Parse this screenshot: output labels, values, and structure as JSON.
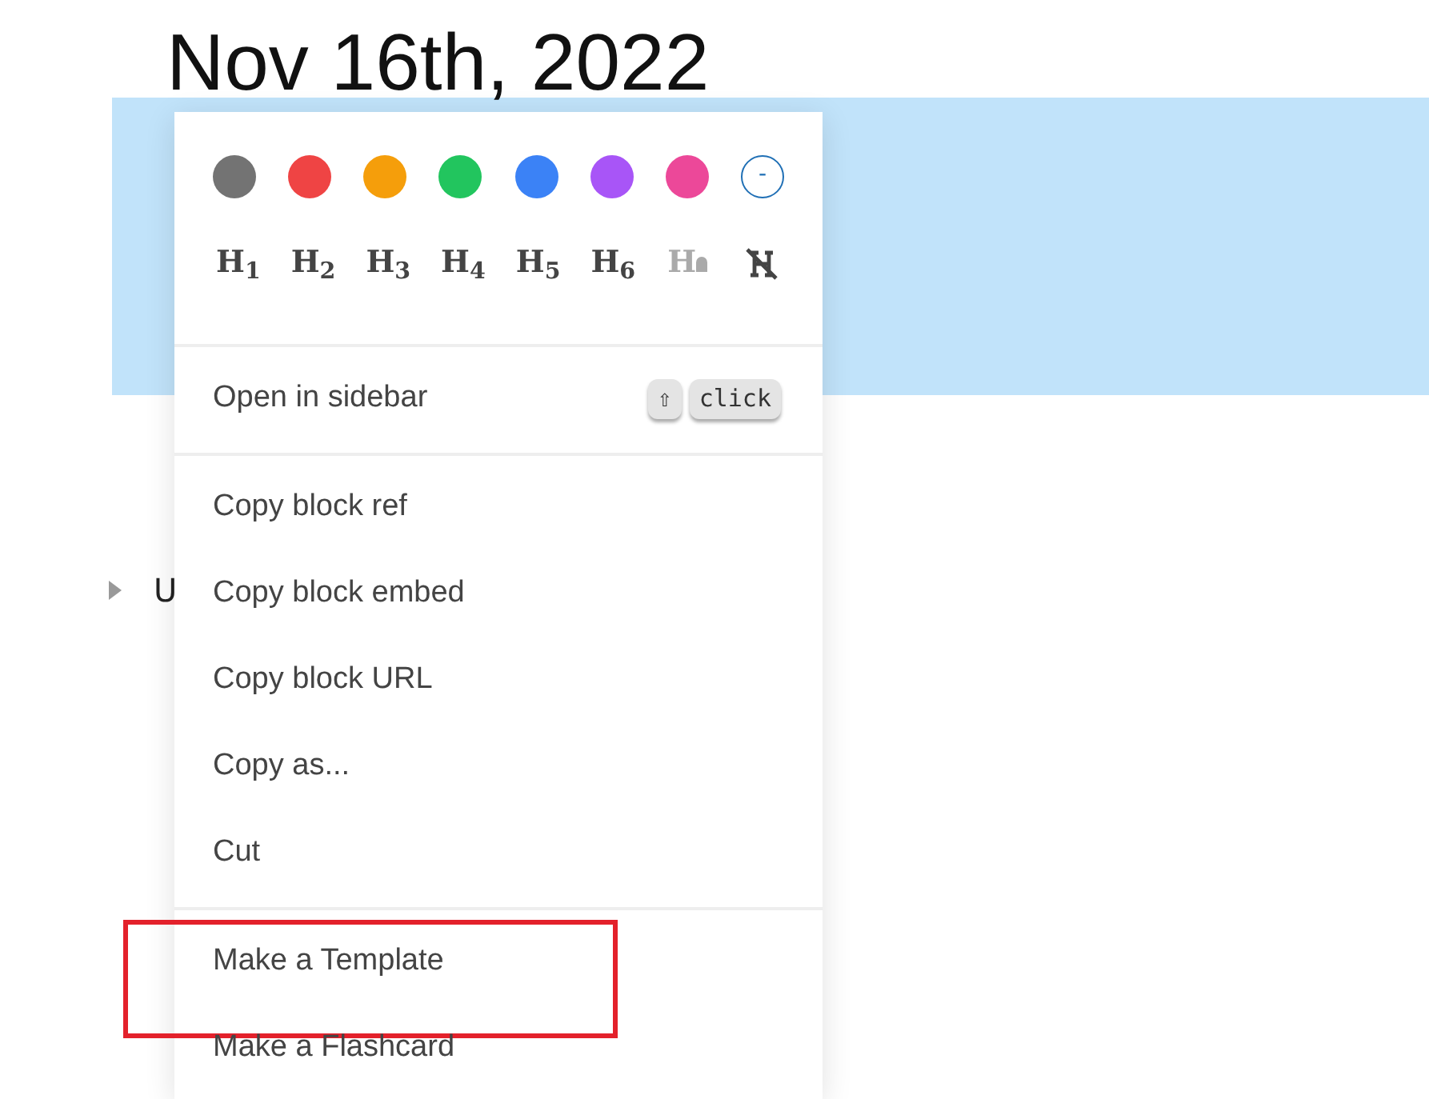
{
  "page": {
    "title": "Nov 16th, 2022",
    "block_selected": true,
    "bullet_text": "U"
  },
  "menu": {
    "colors": [
      {
        "color": "#737373"
      },
      {
        "color": "#ef4444"
      },
      {
        "color": "#f59e0b"
      },
      {
        "color": "#22c55e"
      },
      {
        "color": "#3b82f6"
      },
      {
        "color": "#a855f7"
      },
      {
        "color": "#ec4899"
      },
      {
        "kind": "clear",
        "label": "-"
      }
    ],
    "headings": [
      {
        "kind": "level",
        "label": "H$_{1}$",
        "disabled": false
      },
      {
        "kind": "level",
        "label": "H$_{2}$",
        "disabled": false
      },
      {
        "kind": "level",
        "label": "H$_{3}$",
        "disabled": false
      },
      {
        "kind": "level",
        "label": "H$_{4}$",
        "disabled": false
      },
      {
        "kind": "level",
        "label": "H$_{5}$",
        "disabled": false
      },
      {
        "kind": "level",
        "label": "H$_{6}$",
        "disabled": false
      },
      {
        "kind": "auto",
        "label": "H",
        "disabled": true
      },
      {
        "kind": "none",
        "disabled": false
      }
    ],
    "sections": [
      [
        {
          "label": "Open in sidebar",
          "shortcut": [
            "⇧",
            "click"
          ],
          "highlighted": false
        }
      ],
      [
        {
          "label": "Copy block ref",
          "highlighted": false
        },
        {
          "label": "Copy block embed",
          "highlighted": false
        },
        {
          "label": "Copy block URL",
          "highlighted": false
        },
        {
          "label": "Copy as...",
          "highlighted": false
        },
        {
          "label": "Cut",
          "highlighted": false
        }
      ],
      [
        {
          "label": "Make a Template",
          "highlighted": true
        },
        {
          "label": "Make a Flashcard",
          "highlighted": false
        }
      ]
    ]
  }
}
